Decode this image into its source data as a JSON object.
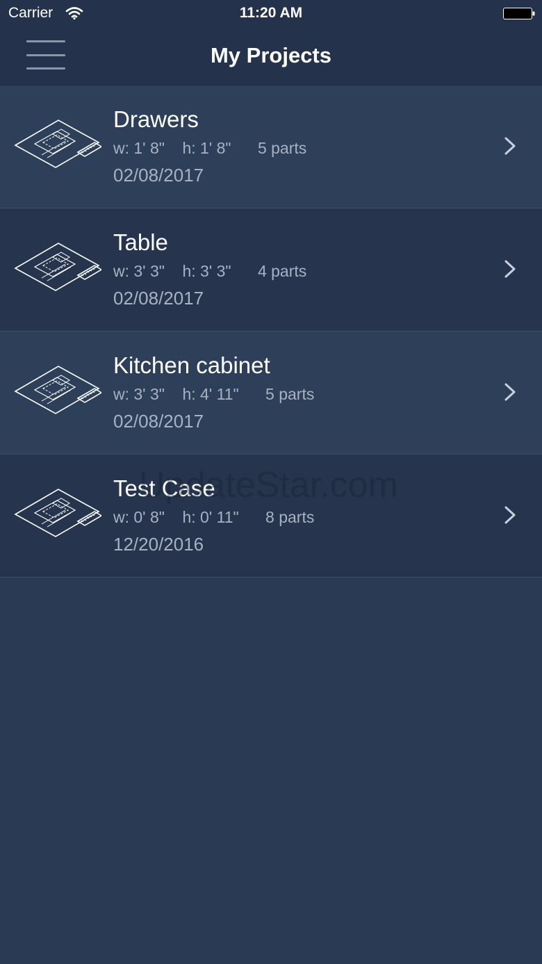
{
  "status_bar": {
    "carrier": "Carrier",
    "time": "11:20 AM"
  },
  "nav": {
    "title": "My Projects"
  },
  "projects": [
    {
      "name": "Drawers",
      "width": "w: 1' 8\"",
      "height": "h: 1' 8\"",
      "parts": "5 parts",
      "date": "02/08/2017"
    },
    {
      "name": "Table",
      "width": "w: 3' 3\"",
      "height": "h: 3' 3\"",
      "parts": "4 parts",
      "date": "02/08/2017"
    },
    {
      "name": "Kitchen cabinet",
      "width": "w: 3' 3\"",
      "height": "h: 4' 11\"",
      "parts": "5 parts",
      "date": "02/08/2017"
    },
    {
      "name": "Test Case",
      "width": "w: 0' 8\"",
      "height": "h: 0' 11\"",
      "parts": "8 parts",
      "date": "12/20/2016"
    }
  ],
  "watermark": "UpdateStar.com",
  "colors": {
    "background": "#2a3a55",
    "bar": "#24334b",
    "row_light": "#2e3f5a",
    "row_dark": "#26354d",
    "secondary_text": "#a8b2c2"
  },
  "icons": {
    "menu": "hamburger-menu-icon",
    "project": "blueprint-icon",
    "disclosure": "chevron-right-icon",
    "wifi": "wifi-icon",
    "battery": "battery-icon"
  }
}
